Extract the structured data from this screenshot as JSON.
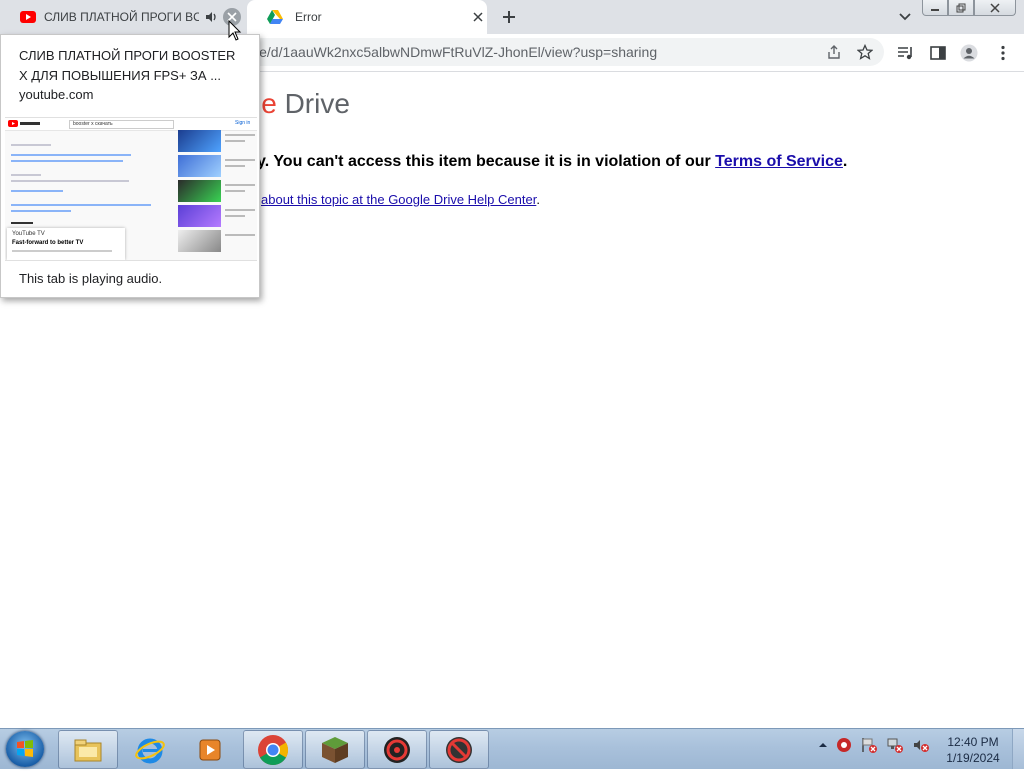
{
  "browser": {
    "tabs": [
      {
        "title": "СЛИВ ПЛАТНОЙ ПРОГИ BOOSTER X ДЛЯ ПОВЫШЕНИЯ FPS+ ЗА ...",
        "favicon": "youtube-icon",
        "playing_audio": true
      },
      {
        "title": "Error",
        "favicon": "google-drive-icon",
        "active": true
      }
    ],
    "url": "drive.google.com/file/d/1aauWk2nxc5albwNDmwFtRuVlZ-JhonEl/view?usp=sharing",
    "url_visible": "le/d/1aauWk2nxc5albwNDmwFtRuVlZ-JhonEl/view?usp=sharing"
  },
  "page": {
    "logo_partial_red": "le",
    "logo_partial_grey": " Drive",
    "message_prefix": "y. You can't access this item because it is in violation of our ",
    "tos_link": "Terms of Service",
    "message_suffix": ".",
    "help_link": "about this topic at the Google Drive Help Center",
    "help_suffix": "."
  },
  "hovercard": {
    "title": "СЛИВ ПЛАТНОЙ ПРОГИ BOOSTER X ДЛЯ ПОВЫШЕНИЯ FPS+ ЗА ...",
    "domain": "youtube.com",
    "audio_status": "This tab is playing audio.",
    "preview": {
      "search_text": "booster x скачать",
      "sign_in": "Sign in",
      "popup_title": "YouTube TV",
      "popup_text": "Fast-forward to better TV"
    }
  },
  "taskbar": {
    "apps": [
      "file-explorer-icon",
      "internet-explorer-icon",
      "media-player-icon",
      "chrome-icon",
      "minecraft-icon",
      "antivirus-icon",
      "blocked-app-icon"
    ],
    "clock_time": "12:40 PM",
    "clock_date": "1/19/2024"
  },
  "colors": {
    "youtube_red": "#ff0000",
    "link_blue": "#1a0dab",
    "drive_red": "#ea4335",
    "tabstrip": "#dee1e6"
  }
}
